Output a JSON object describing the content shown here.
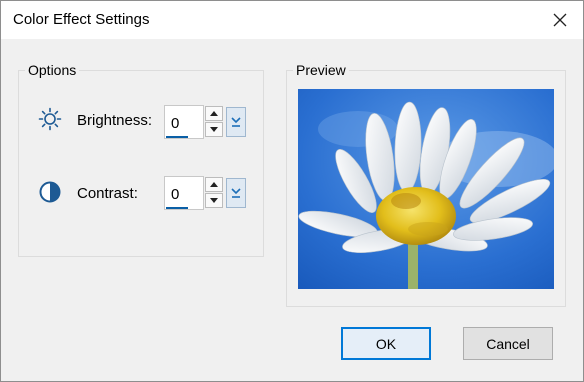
{
  "window": {
    "title": "Color Effect Settings"
  },
  "options": {
    "group_title": "Options",
    "brightness": {
      "label": "Brightness:",
      "value": "0",
      "icon": "sun-icon"
    },
    "contrast": {
      "label": "Contrast:",
      "value": "0",
      "icon": "contrast-icon"
    }
  },
  "preview": {
    "group_title": "Preview",
    "image": "daisy-flower-photo"
  },
  "buttons": {
    "ok": "OK",
    "cancel": "Cancel"
  },
  "colors": {
    "accent": "#0078d7",
    "icon_blue": "#1d5a94",
    "sky": "#1f63c8"
  }
}
